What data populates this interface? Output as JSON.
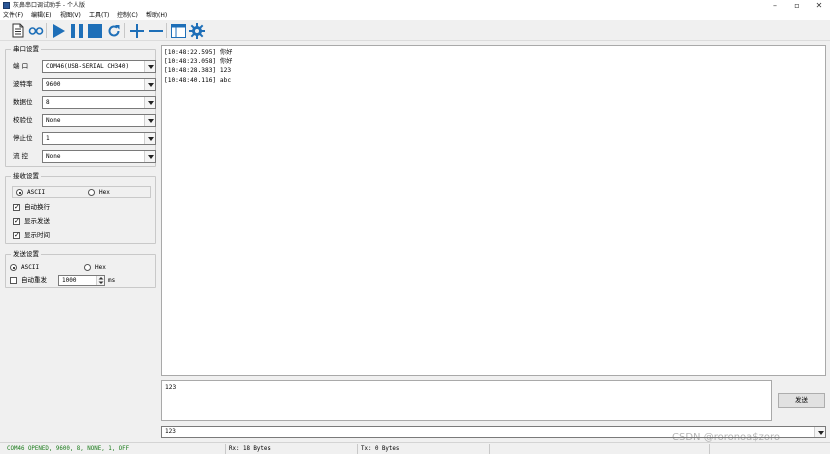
{
  "window": {
    "title": "灰鼻串口调试助手 - 个人版",
    "minimize": "–",
    "maximize": "▫",
    "close": "✕"
  },
  "menu": [
    {
      "label": "文件(F)"
    },
    {
      "label": "编辑(E)"
    },
    {
      "label": "视图(V)"
    },
    {
      "label": "工具(T)"
    },
    {
      "label": "控制(C)"
    },
    {
      "label": "帮助(H)"
    }
  ],
  "toolbar": {
    "icons": [
      "document-icon",
      "loop-icon",
      "play-icon",
      "pause-icon",
      "stop-icon",
      "refresh-icon",
      "plus-icon",
      "minus-icon",
      "window-icon",
      "gear-icon"
    ]
  },
  "serial_settings": {
    "title": "串口设置",
    "rows": [
      {
        "label": "端  口",
        "value": "COM46(USB-SERIAL CH340)"
      },
      {
        "label": "波特率",
        "value": "9600"
      },
      {
        "label": "数据位",
        "value": "8"
      },
      {
        "label": "校验位",
        "value": "None"
      },
      {
        "label": "停止位",
        "value": "1"
      },
      {
        "label": "流  控",
        "value": "None"
      }
    ]
  },
  "receive_settings": {
    "title": "接收设置",
    "mode_ascii": "ASCII",
    "mode_hex": "Hex",
    "selected_mode": "ASCII",
    "options": [
      {
        "label": "自动换行",
        "checked": true
      },
      {
        "label": "显示发送",
        "checked": true
      },
      {
        "label": "显示时间",
        "checked": true
      }
    ]
  },
  "send_settings": {
    "title": "发送设置",
    "mode_ascii": "ASCII",
    "mode_hex": "Hex",
    "selected_mode": "ASCII",
    "auto_resend_label": "自动重发",
    "auto_resend_checked": false,
    "interval": "1000",
    "interval_unit": "ms"
  },
  "receive_log": [
    "[10:48:22.595] 你好",
    "[10:48:23.058] 你好",
    "[10:48:28.383] 123",
    "[10:48:40.116] abc"
  ],
  "send": {
    "text": "123",
    "button_label": "发送",
    "history_value": "123"
  },
  "status": {
    "connection": "COM46 OPENED, 9600, 8, NONE, 1, OFF",
    "rx": "Rx: 18 Bytes",
    "tx": "Tx: 0 Bytes"
  },
  "watermark": "CSDN @roronoa$zoro",
  "colors": {
    "accent": "#1e6fb8",
    "status_text": "#1a7a1a"
  }
}
